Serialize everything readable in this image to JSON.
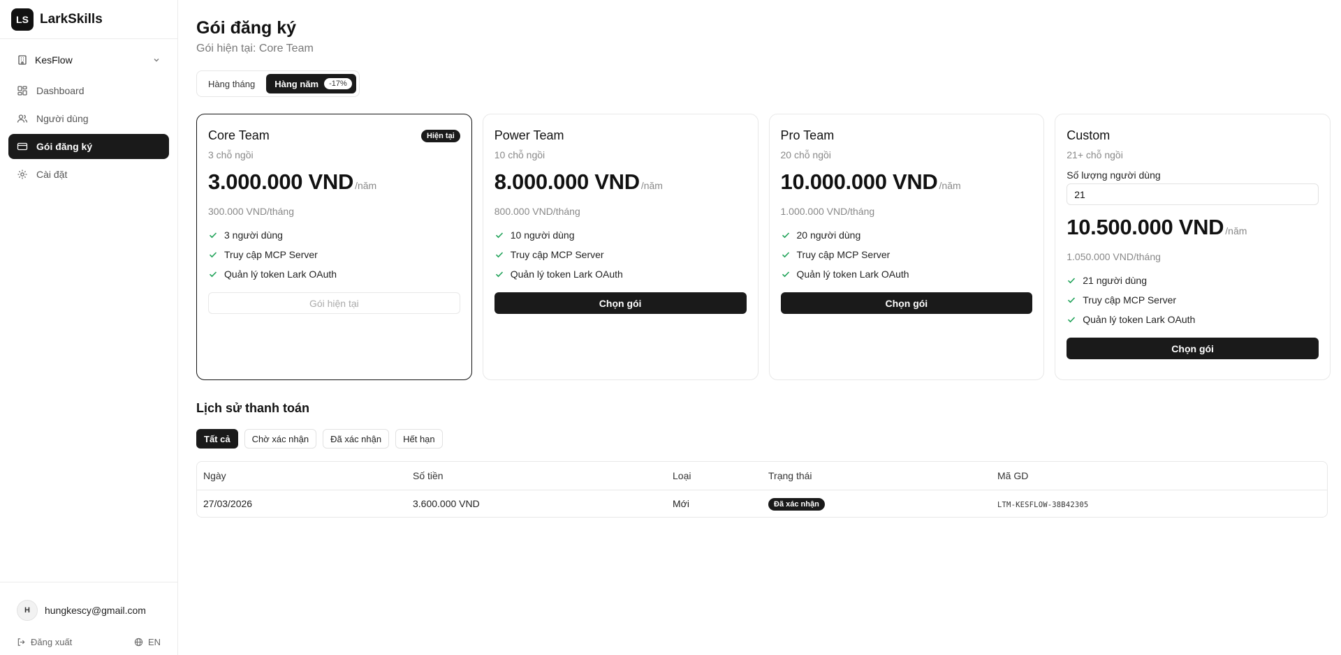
{
  "brand": {
    "logo_text": "LS",
    "name": "LarkSkills"
  },
  "org": {
    "name": "KesFlow"
  },
  "nav": [
    {
      "label": "Dashboard",
      "icon": "grid-icon",
      "active": false
    },
    {
      "label": "Người dùng",
      "icon": "users-icon",
      "active": false
    },
    {
      "label": "Gói đăng ký",
      "icon": "credit-card-icon",
      "active": true
    },
    {
      "label": "Cài đặt",
      "icon": "gear-icon",
      "active": false
    }
  ],
  "user": {
    "avatar": "H",
    "email": "hungkescy@gmail.com"
  },
  "footer": {
    "logout": "Đăng xuất",
    "language": "EN"
  },
  "page": {
    "title": "Gói đăng ký",
    "subtitle": "Gói hiện tại: Core Team"
  },
  "billing_toggle": {
    "monthly": "Hàng tháng",
    "yearly": "Hàng năm",
    "discount": "-17%",
    "selected": "yearly"
  },
  "plans": [
    {
      "name": "Core Team",
      "badge": "Hiện tại",
      "seats": "3 chỗ ngồi",
      "price": "3.000.000 VND",
      "unit": "/năm",
      "monthly": "300.000 VND/tháng",
      "features": [
        "3 người dùng",
        "Truy cập MCP Server",
        "Quản lý token Lark OAuth"
      ],
      "button": "Gói hiện tại"
    },
    {
      "name": "Power Team",
      "seats": "10 chỗ ngồi",
      "price": "8.000.000 VND",
      "unit": "/năm",
      "monthly": "800.000 VND/tháng",
      "features": [
        "10 người dùng",
        "Truy cập MCP Server",
        "Quản lý token Lark OAuth"
      ],
      "button": "Chọn gói"
    },
    {
      "name": "Pro Team",
      "seats": "20 chỗ ngồi",
      "price": "10.000.000 VND",
      "unit": "/năm",
      "monthly": "1.000.000 VND/tháng",
      "features": [
        "20 người dùng",
        "Truy cập MCP Server",
        "Quản lý token Lark OAuth"
      ],
      "button": "Chọn gói"
    },
    {
      "name": "Custom",
      "seats": "21+ chỗ ngồi",
      "qty_label": "Số lượng người dùng",
      "qty_value": "21",
      "price": "10.500.000 VND",
      "unit": "/năm",
      "monthly": "1.050.000 VND/tháng",
      "features": [
        "21 người dùng",
        "Truy cập MCP Server",
        "Quản lý token Lark OAuth"
      ],
      "button": "Chọn gói"
    }
  ],
  "history": {
    "title": "Lịch sử thanh toán",
    "filters": [
      {
        "label": "Tất cả",
        "active": true
      },
      {
        "label": "Chờ xác nhận",
        "active": false
      },
      {
        "label": "Đã xác nhận",
        "active": false
      },
      {
        "label": "Hết hạn",
        "active": false
      }
    ],
    "columns": [
      "Ngày",
      "Số tiền",
      "Loại",
      "Trạng thái",
      "Mã GD"
    ],
    "rows": [
      {
        "date": "27/03/2026",
        "amount": "3.600.000 VND",
        "type": "Mới",
        "status": "Đã xác nhận",
        "code": "LTM-KESFLOW-38B42305"
      }
    ]
  },
  "colors": {
    "primary": "#1a1a1a",
    "check": "#22a35a",
    "muted": "#888888",
    "border": "#e8e8e8"
  }
}
